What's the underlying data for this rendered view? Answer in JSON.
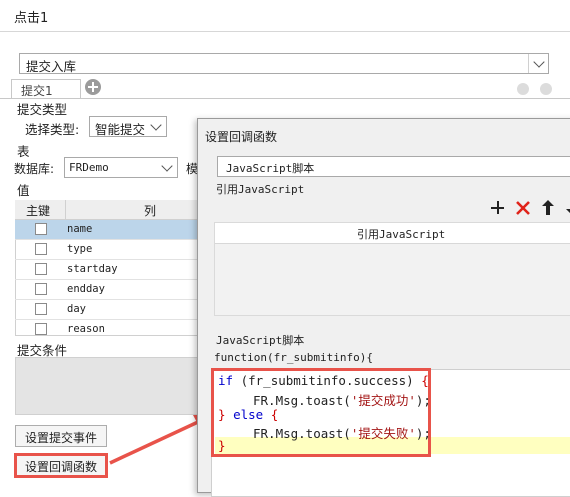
{
  "page": {
    "title": "点击1",
    "submit_action": "提交入库",
    "tab_label": "提交1",
    "submit_type_label": "提交类型",
    "select_type_label": "选择类型:",
    "select_type_value": "智能提交",
    "table_label": "表",
    "db_label": "数据库:",
    "db_value": "FRDemo",
    "table_prefix": "模",
    "value_label": "值",
    "col_primary_key": "主键",
    "col_column": "列",
    "rows": [
      "name",
      "type",
      "startday",
      "endday",
      "day",
      "reason"
    ],
    "submit_condition_label": "提交条件",
    "set_submit_event": "设置提交事件",
    "set_callback": "设置回调函数"
  },
  "dialog": {
    "title": "设置回调函数",
    "type_value": "JavaScript脚本",
    "ref_label": "引用JavaScript",
    "ref_column": "引用JavaScript",
    "script_label": "JavaScript脚本",
    "function_signature": "function(fr_submitinfo){",
    "code": {
      "l1_kw": "if",
      "l1_cond": "(fr_submitinfo.success)",
      "l1_brace": "{",
      "l2_call": "FR.Msg.toast(",
      "l2_str": "'提交成功'",
      "l2_end": ");",
      "l3_brace1": "}",
      "l3_kw": "else",
      "l3_brace2": "{",
      "l4_call": "FR.Msg.toast(",
      "l4_str": "'提交失败'",
      "l4_end": ");",
      "l5_brace": "}"
    }
  },
  "colors": {
    "highlight": "#e8534a",
    "selected_row": "#bcd5ea",
    "current_line": "#ffffc0"
  }
}
